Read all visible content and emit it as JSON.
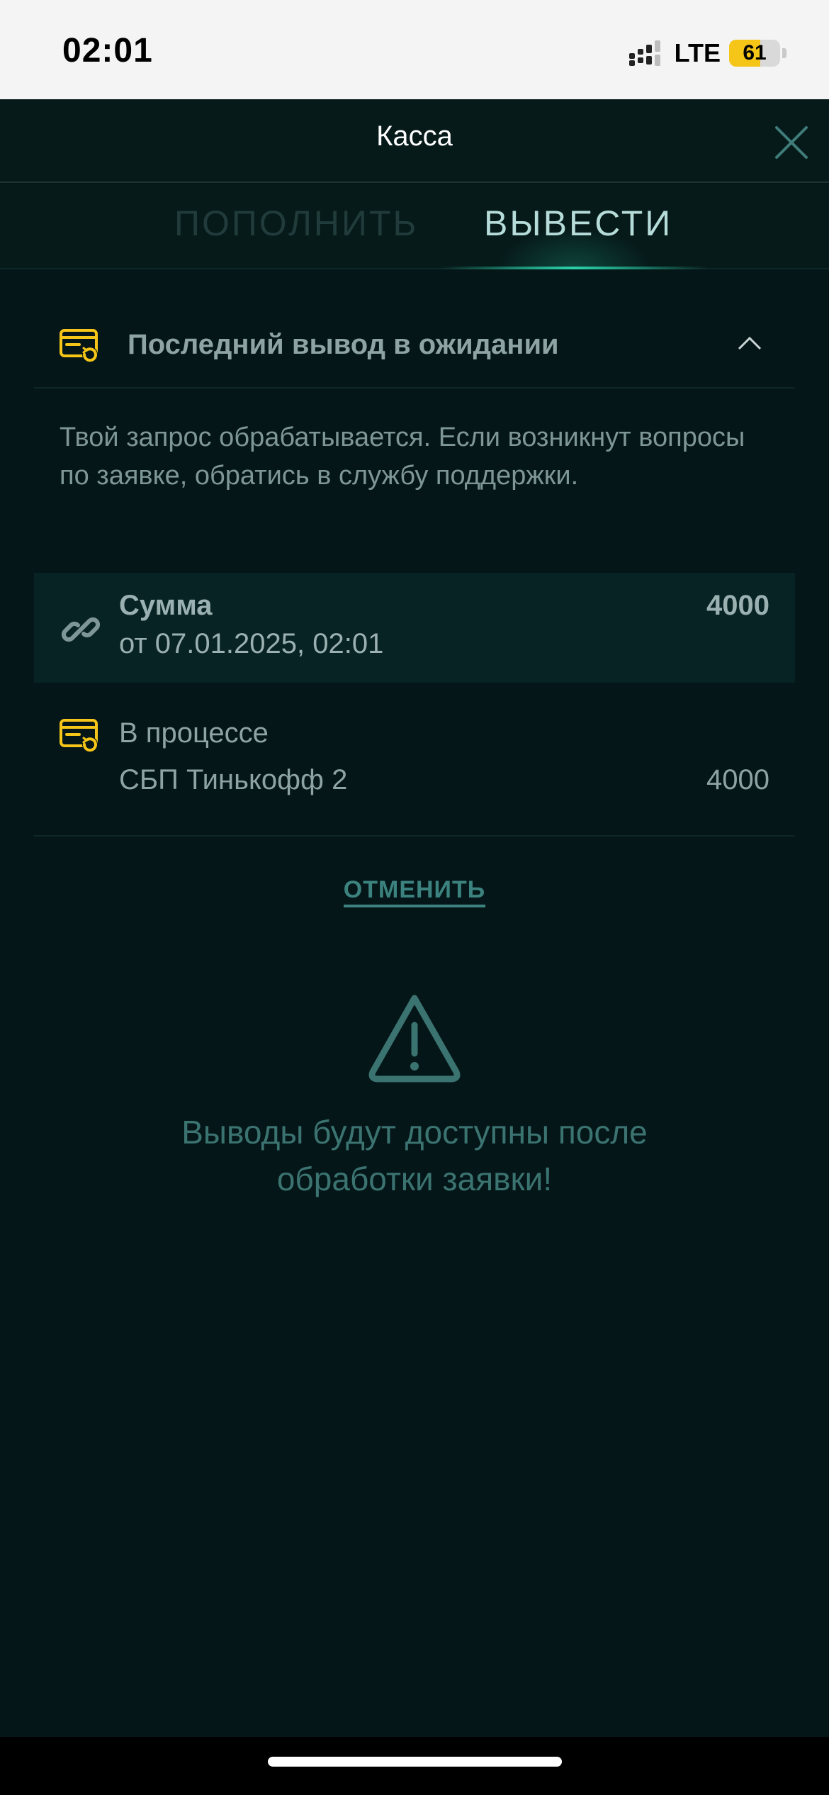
{
  "status_bar": {
    "time": "02:01",
    "network": "LTE",
    "battery_percent": "61",
    "battery_level": 0.61
  },
  "header": {
    "title": "Касса",
    "close_icon": "close-icon"
  },
  "tabs": [
    {
      "label": "ПОПОЛНИТЬ",
      "active": false
    },
    {
      "label": "ВЫВЕСТИ",
      "active": true
    }
  ],
  "pending": {
    "title": "Последний вывод в ожидании",
    "expanded": true,
    "icon": "card-refresh-icon",
    "info": "Твой запрос обрабатывается. Если возникнут вопросы по заявке, обратись в службу поддержки."
  },
  "sum_card": {
    "label": "Сумма",
    "date": "от 07.01.2025, 02:01",
    "value": "4000",
    "icon": "link-icon"
  },
  "process": {
    "status": "В процессе",
    "method": "СБП Тинькофф 2",
    "value": "4000",
    "icon": "card-refresh-icon"
  },
  "cancel_label": "ОТМЕНИТЬ",
  "warning": {
    "icon": "warning-icon",
    "text": "Выводы будут доступны после обработки заявки!"
  },
  "colors": {
    "background": "#041617",
    "accent": "#2ad1a8",
    "icon_yellow": "#f5c518",
    "muted_teal": "#3b7371"
  }
}
